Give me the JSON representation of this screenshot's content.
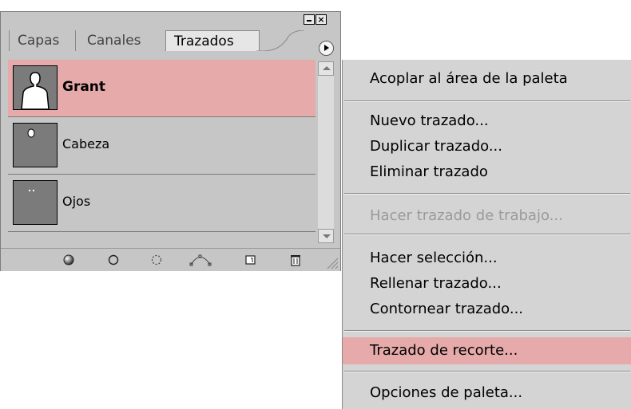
{
  "palette": {
    "tabs": [
      {
        "label": "Capas"
      },
      {
        "label": "Canales"
      },
      {
        "label": "Trazados"
      }
    ],
    "active_tab": "Trazados",
    "paths": [
      {
        "name": "Grant",
        "selected": true
      },
      {
        "name": "Cabeza",
        "selected": false
      },
      {
        "name": "Ojos",
        "selected": false
      }
    ],
    "bottom_icons": [
      "fill-path-icon",
      "stroke-path-icon",
      "load-selection-icon",
      "make-work-path-icon",
      "new-path-icon",
      "trash-icon"
    ]
  },
  "menu": {
    "items": [
      {
        "label": "Acoplar al área de la paleta"
      },
      {
        "label": "Nuevo trazado..."
      },
      {
        "label": "Duplicar trazado..."
      },
      {
        "label": "Eliminar trazado"
      },
      {
        "label": "Hacer trazado de trabajo...",
        "disabled": true
      },
      {
        "label": "Hacer selección..."
      },
      {
        "label": "Rellenar trazado..."
      },
      {
        "label": "Contornear trazado..."
      },
      {
        "label": "Trazado de recorte...",
        "highlighted": true
      },
      {
        "label": "Opciones de paleta..."
      }
    ]
  },
  "colors": {
    "selection": "#e6aaaa",
    "panel": "#c6c6c6",
    "menu": "#d4d4d4"
  }
}
